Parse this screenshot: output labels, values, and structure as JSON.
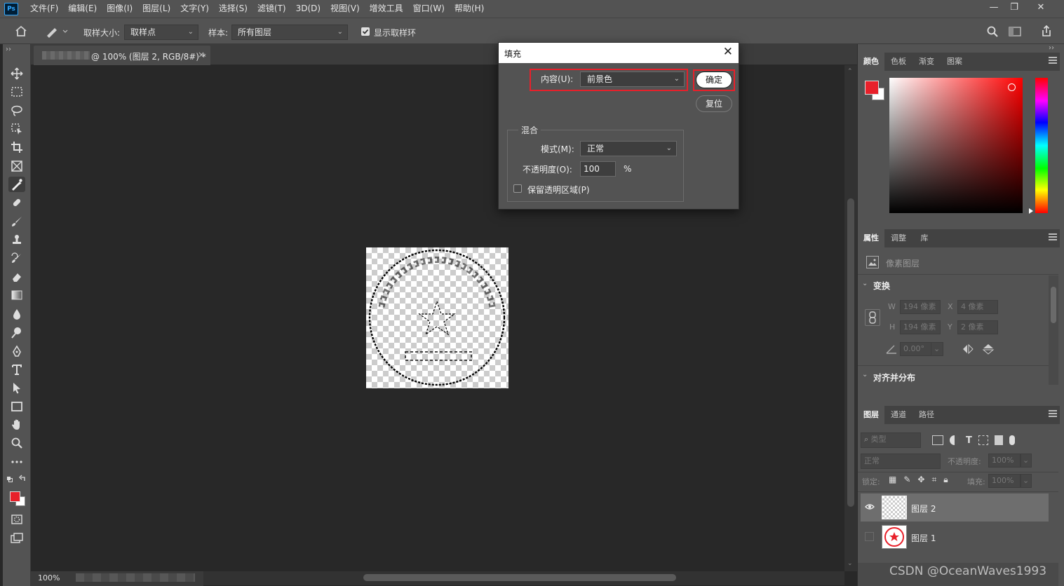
{
  "app": {
    "logo": "Ps"
  },
  "menu": [
    "文件(F)",
    "编辑(E)",
    "图像(I)",
    "图层(L)",
    "文字(Y)",
    "选择(S)",
    "滤镜(T)",
    "3D(D)",
    "视图(V)",
    "增效工具",
    "窗口(W)",
    "帮助(H)"
  ],
  "window_controls": {
    "minimize": "—",
    "restore": "❐",
    "close": "✕"
  },
  "options": {
    "sample_size_label": "取样大小:",
    "sample_size_value": "取样点",
    "sample_label": "样本:",
    "sample_value": "所有图层",
    "show_ring_label": "显示取样环",
    "show_ring_checked": true
  },
  "document_tab": {
    "title": "@ 100% (图层 2, RGB/8#) *",
    "close": "×"
  },
  "status": {
    "zoom": "100%"
  },
  "panels": {
    "color_tabs": [
      "颜色",
      "色板",
      "渐变",
      "图案"
    ],
    "foreground_color": "#e8202a",
    "background_color": "#ffffff",
    "props_tabs": [
      "属性",
      "调整",
      "库"
    ],
    "pixel_layer_label": "像素图层",
    "transform_header": "变换",
    "transform": {
      "w_label": "W",
      "w_value": "194 像素",
      "x_label": "X",
      "x_value": "4 像素",
      "h_label": "H",
      "h_value": "194 像素",
      "y_label": "Y",
      "y_value": "2 像素",
      "angle_value": "0.00°"
    },
    "align_header": "对齐并分布",
    "layers_tabs": [
      "图层",
      "通道",
      "路径"
    ],
    "filter_placeholder": "类型",
    "blend_mode": "正常",
    "opacity_label": "不透明度:",
    "opacity_value": "100%",
    "lock_label": "锁定:",
    "fill_label": "填充:",
    "fill_value": "100%",
    "layers": [
      {
        "name": "图层 2",
        "visible": true,
        "selected": true
      },
      {
        "name": "图层 1",
        "visible": false,
        "selected": false
      }
    ]
  },
  "dialog": {
    "title": "填充",
    "close": "✕",
    "content_label": "内容(U):",
    "content_value": "前景色",
    "ok_label": "确定",
    "reset_label": "复位",
    "blend_group": "混合",
    "mode_label": "模式(M):",
    "mode_value": "正常",
    "opacity_label": "不透明度(O):",
    "opacity_value": "100",
    "opacity_unit": "%",
    "preserve_label": "保留透明区域(P)",
    "preserve_checked": false
  },
  "watermark": "CSDN @OceanWaves1993"
}
